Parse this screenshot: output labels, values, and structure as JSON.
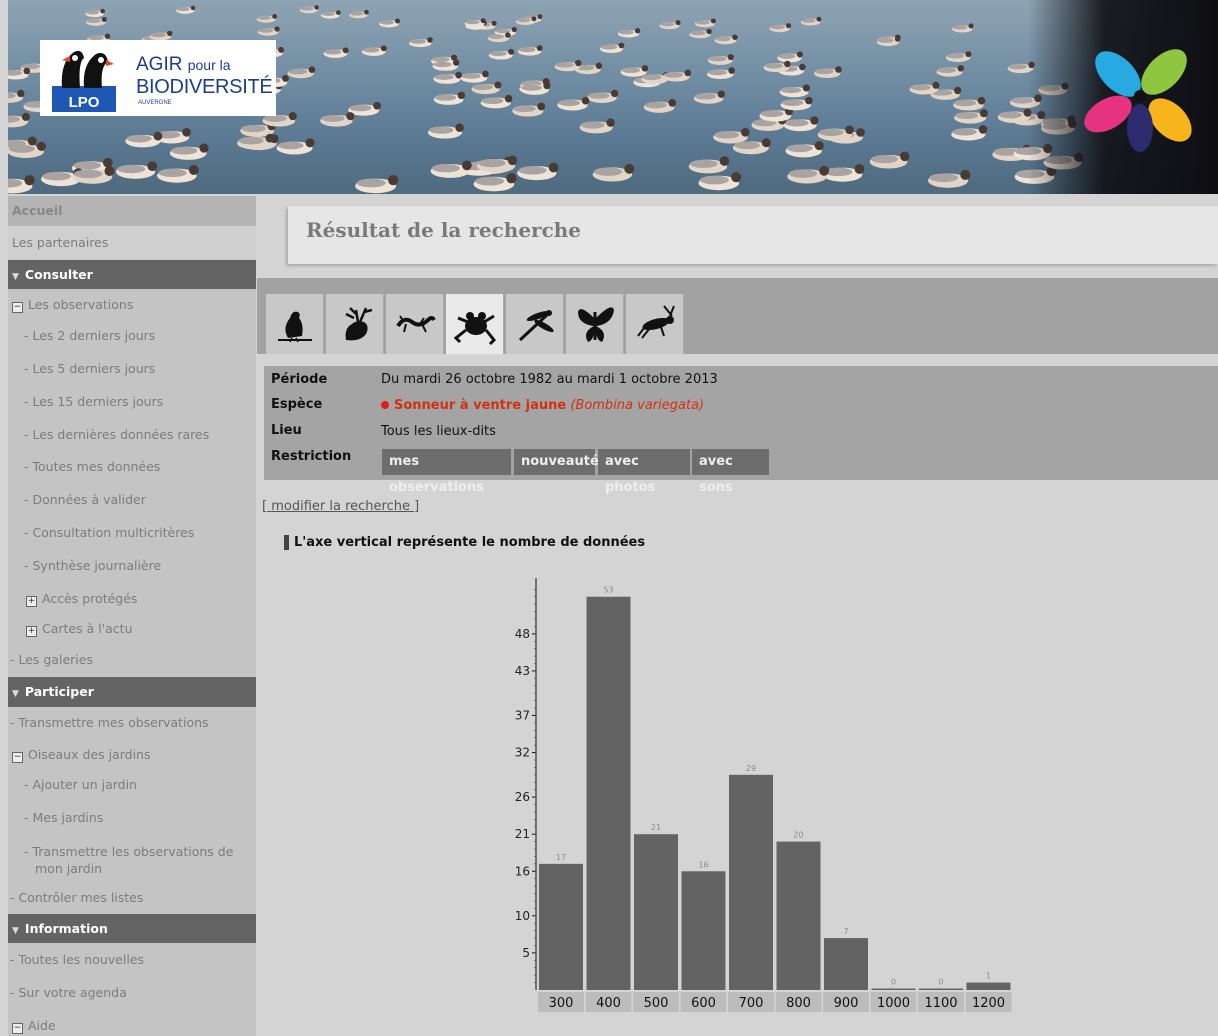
{
  "header": {
    "logo_mark": "LPO",
    "logo_agir": "AGIR",
    "logo_pour": "pour la",
    "logo_bio": "BIODIVERSITÉ",
    "logo_region": "AUVERGNE"
  },
  "sidebar": {
    "accueil": "Accueil",
    "partenaires": "Les partenaires",
    "consulter": "Consulter",
    "observations": "Les observations",
    "obs_items": [
      "- Les 2 derniers jours",
      "- Les 5 derniers jours",
      "- Les 15 derniers jours",
      "- Les dernières données rares",
      "- Toutes mes données",
      "- Données à valider",
      "- Consultation multicritères",
      "- Synthèse journalière"
    ],
    "acces_proteges": "Accès protégés",
    "cartes_actu": "Cartes à l'actu",
    "galeries": "- Les galeries",
    "participer": "Participer",
    "transmettre": "- Transmettre mes observations",
    "oiseaux_jardins": "Oiseaux des jardins",
    "ajouter_jardin": "- Ajouter un jardin",
    "mes_jardins": "- Mes jardins",
    "transmettre_jardin_1": "- Transmettre les observations de",
    "transmettre_jardin_2": "mon jardin",
    "controler": "- Contrôler mes listes",
    "information": "Information",
    "nouvelles": "- Toutes les nouvelles",
    "agenda": "- Sur votre agenda",
    "aide": "Aide"
  },
  "main": {
    "title": "Résultat de la recherche",
    "tabs": [
      "birds-icon",
      "mammals-icon",
      "reptiles-icon",
      "amphibians-icon",
      "odonata-icon",
      "butterflies-icon",
      "orthoptera-icon"
    ],
    "active_tab": "amphibians-icon",
    "criteria": {
      "periode_label": "Période",
      "periode_value": "Du mardi 26 octobre 1982 au mardi 1 octobre 2013",
      "espece_label": "Espèce",
      "espece_value": "Sonneur à ventre jaune",
      "espece_latin": "(Bombina variegata)",
      "lieu_label": "Lieu",
      "lieu_value": "Tous les lieux-dits",
      "restriction_label": "Restriction",
      "restrictions": [
        "mes observations",
        "nouveauté",
        "avec photos",
        "avec sons"
      ]
    },
    "modify_link": "modifier la recherche",
    "modify_open": "[ ",
    "modify_close": " ]",
    "chart_heading": "L'axe vertical représente le nombre de données"
  },
  "colors": {
    "accent_species": "#d32f12",
    "bar": "#636363",
    "sidebar_header": "#646464"
  },
  "chart_data": {
    "type": "bar",
    "title": "L'axe vertical représente le nombre de données",
    "categories": [
      "300",
      "400",
      "500",
      "600",
      "700",
      "800",
      "900",
      "1000",
      "1100",
      "1200"
    ],
    "values": [
      17,
      53,
      21,
      16,
      29,
      20,
      7,
      0,
      0,
      1
    ],
    "y_ticks": [
      5,
      10,
      16,
      21,
      26,
      32,
      37,
      43,
      48
    ],
    "ylim": [
      0,
      55
    ],
    "grid": false,
    "legend": "none"
  }
}
